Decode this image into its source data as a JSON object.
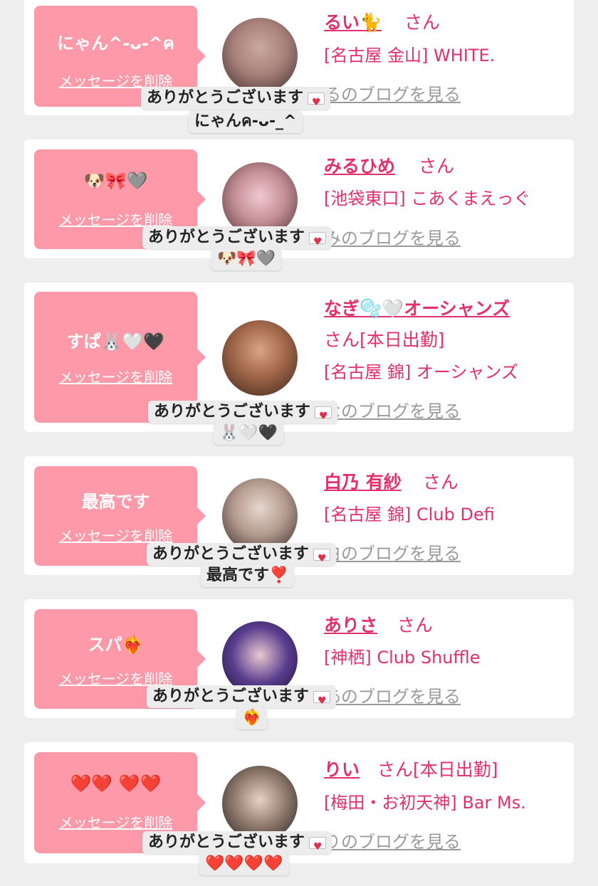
{
  "tooltip_prefix": "ありがとうございます",
  "blog_link_label": "のブログを見る",
  "blog_link_prefixes": [
    "る",
    "み",
    "な",
    "白",
    "あ",
    "り"
  ],
  "san_label": "さん",
  "messages": [
    {
      "text": "にゃん^-ᴗ-^ค",
      "delete_label": "メッセージを削除",
      "cast_name": "るい🐈",
      "san": "さん",
      "shop": "[名古屋 金山] WHITE.",
      "tooltip_line2": "にゃんค-ᴗ-_^",
      "avatar_colors": [
        "#caa8a0",
        "#3a2a28"
      ]
    },
    {
      "text": "🐶🎀🩶",
      "delete_label": "メッセージを削除",
      "cast_name": "みるひめ",
      "san": "さん",
      "shop": "[池袋東口] こあくまえっぐ",
      "tooltip_line2": "🐶🎀🩶",
      "avatar_colors": [
        "#f1c9cf",
        "#4a2d30"
      ]
    },
    {
      "text": "すぱ🐰🤍🖤",
      "delete_label": "メッセージを削除",
      "cast_name": "なぎ🫧🤍オーシャンズ",
      "san": "さん[本日出勤]",
      "shop": "[名古屋 錦] オーシャンズ",
      "tooltip_line2": "🐰🤍🖤",
      "avatar_colors": [
        "#d9a486",
        "#3b2419"
      ]
    },
    {
      "text": "最高です",
      "delete_label": "メッセージを削除",
      "cast_name": "白乃 有紗",
      "san": "さん",
      "shop": "[名古屋 錦] Club Defi",
      "tooltip_line2": "最高です❣️",
      "avatar_colors": [
        "#e6d7cf",
        "#2a2222"
      ]
    },
    {
      "text": "スパ❤️‍🔥",
      "delete_label": "メッセージを削除",
      "cast_name": "ありさ",
      "san": "さん",
      "shop": "[神栖] Club Shuffle",
      "tooltip_line2": "❤️‍🔥",
      "avatar_colors": [
        "#5a3d8f",
        "#1a1230"
      ]
    },
    {
      "text": "❤️❤️ ❤️❤️",
      "delete_label": "メッセージを削除",
      "cast_name": "りい",
      "san": "さん[本日出勤]",
      "shop": "[梅田・お初天神] Bar Ms.",
      "tooltip_line2": "❤️❤️❤️❤️",
      "avatar_colors": [
        "#e8d2c4",
        "#1c1c1c"
      ]
    }
  ]
}
